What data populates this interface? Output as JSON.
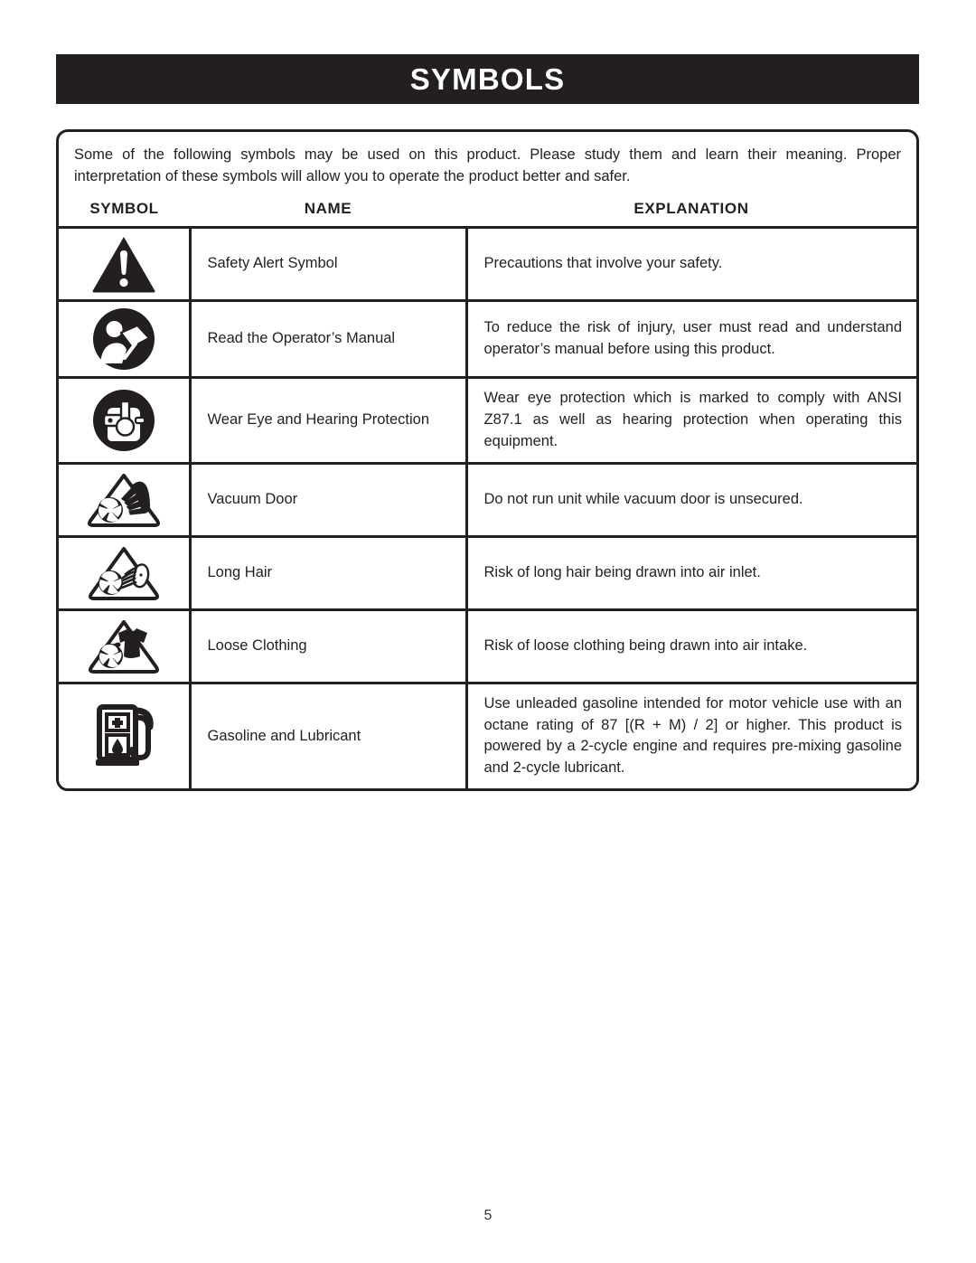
{
  "header": {
    "title": "SYMBOLS"
  },
  "intro": {
    "text": "Some of the following symbols may be used on this product. Please study them and learn their meaning. Proper interpretation of these symbols will allow you to operate the product better and safer."
  },
  "table": {
    "columns": {
      "symbol": "SYMBOL",
      "name": "NAME",
      "explanation": "EXPLANATION"
    },
    "rows": [
      {
        "icon": "safety-alert-triangle-icon",
        "name": "Safety Alert Symbol",
        "explanation": "Precautions that involve your safety."
      },
      {
        "icon": "read-operators-manual-icon",
        "name": "Read the Operator’s Manual",
        "explanation": "To reduce the risk of injury, user must read and understand operator’s manual before using this product."
      },
      {
        "icon": "eye-hearing-protection-icon",
        "name": "Wear Eye and Hearing Protection",
        "explanation": "Wear eye protection which is marked to comply with ANSI Z87.1 as well as hearing protection when operating this equipment."
      },
      {
        "icon": "vacuum-door-hand-impeller-icon",
        "name": "Vacuum Door",
        "explanation": "Do not run unit while vacuum door is unsecured."
      },
      {
        "icon": "long-hair-impeller-icon",
        "name": "Long Hair",
        "explanation": "Risk of long hair being drawn into air inlet."
      },
      {
        "icon": "loose-clothing-impeller-icon",
        "name": "Loose Clothing",
        "explanation": "Risk of loose clothing being drawn into air intake."
      },
      {
        "icon": "gasoline-pump-icon",
        "name": "Gasoline and Lubricant",
        "explanation": "Use unleaded gasoline intended for motor vehicle use with an octane rating of 87 [(R + M) / 2] or higher. This product is powered by a 2-cycle engine and requires pre-mixing gasoline and 2-cycle lubricant."
      }
    ]
  },
  "footer": {
    "page_number": "5"
  },
  "colors": {
    "ink": "#231f1f",
    "paper": "#ffffff"
  }
}
